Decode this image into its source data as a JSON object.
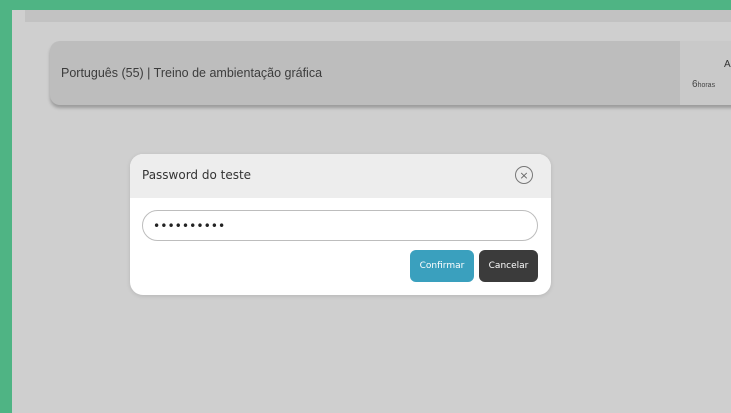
{
  "exam": {
    "title": "Português (55) | Treino de ambientação gráfica",
    "side_letter": "A",
    "hours_value": "6",
    "hours_unit": "horas"
  },
  "modal": {
    "title": "Password do teste",
    "password_value": "••••••••••",
    "confirm_label": "Confirmar",
    "cancel_label": "Cancelar",
    "close_icon": "×"
  },
  "colors": {
    "frame_green": "#4fb484",
    "confirm_button": "#3aa0be",
    "cancel_button": "#3b3b3b"
  }
}
